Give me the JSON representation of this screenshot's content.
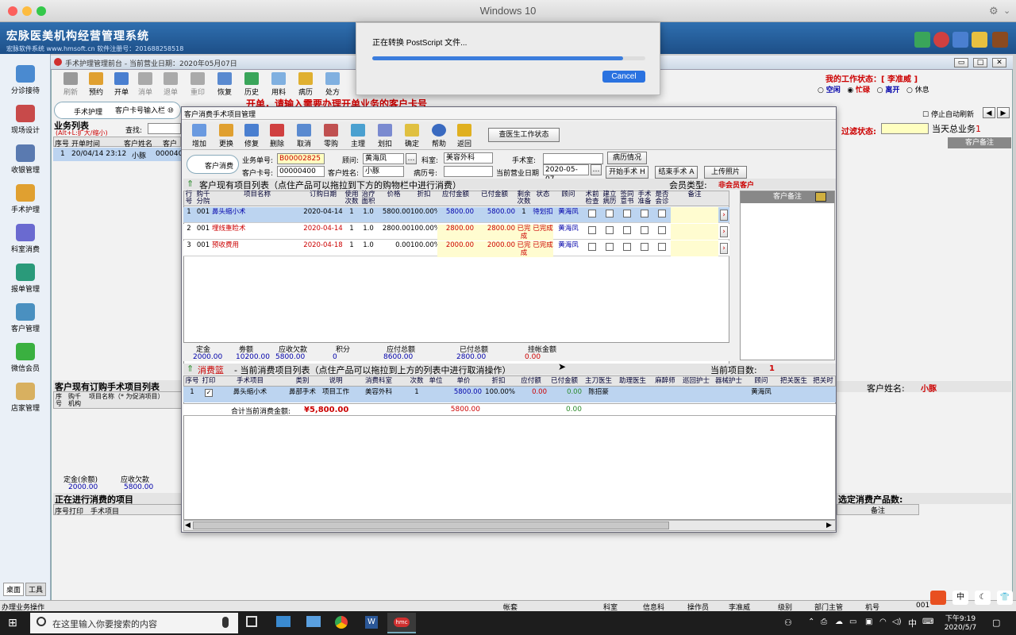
{
  "window": {
    "title": "Windows 10"
  },
  "app": {
    "title": "宏脉医美机构经营管理系统",
    "subtitle": "宏脉软件系统  www.hmsoft.cn  软件注册号：201688258518"
  },
  "sidebar": {
    "items": [
      {
        "label": "分诊接待"
      },
      {
        "label": "现场设计"
      },
      {
        "label": "收银管理"
      },
      {
        "label": "手术护理"
      },
      {
        "label": "科室消费"
      },
      {
        "label": "报单管理"
      },
      {
        "label": "客户管理"
      },
      {
        "label": "微信会员"
      },
      {
        "label": "店家管理"
      }
    ],
    "tabs": [
      "桌面",
      "工具"
    ]
  },
  "inner": {
    "title": "手术护理管理前台 - 当前营业日期：2020年05月07日"
  },
  "toolbar": {
    "items": [
      "刷新",
      "预约",
      "开单",
      "消单",
      "退单",
      "重印",
      "恢复",
      "历史",
      "用料",
      "病历",
      "处方"
    ]
  },
  "status": {
    "label": "我的工作状态：[ 李准威 ]",
    "options": [
      "空闲",
      "忙碌",
      "离开",
      "休息"
    ],
    "auto_refresh": "停止自动刷新"
  },
  "left_panel": {
    "surgery_tag": "手术护理",
    "card_input_label": "客户卡号输入栏 ⑩",
    "prompt": "开单，请输入需要办理开单业务的客户卡号",
    "business_list": "业务列表",
    "business_hint": "(Alt+L:扩大/缩小)",
    "search": "查找:",
    "cols": [
      "序号",
      "开单时间",
      "客户姓名",
      "客户"
    ],
    "row": [
      "1",
      "20/04/14 23:12",
      "小豚",
      "000040"
    ],
    "filter": "过滤状态:",
    "today": "当天总业务",
    "today_count": "1",
    "note_col": "客户备注",
    "order_title": "客户现有订购手术项目列表",
    "order_cols": [
      "序号",
      "购千机构",
      "项目名称（* 为促消项目）"
    ],
    "deposit_label": "定金(余额)",
    "deposit_val": "2000.00",
    "owed_label": "应收欠款",
    "owed_val": "5800.00",
    "ongoing": "正在进行消费的项目",
    "ongoing_cols": [
      "序号打印",
      "手术项目"
    ],
    "customer_name_label": "客户姓名:",
    "customer_name": "小豚",
    "selected_count": "选定消费产品数:",
    "note2": "备注"
  },
  "dialog": {
    "title": "客户消费手术项目管理",
    "toolbar": [
      "增加",
      "更换",
      "修复",
      "删除",
      "取消",
      "零购",
      "主理",
      "划扣",
      "确定",
      "帮助",
      "返回"
    ],
    "check_doctor": "查医生工作状态",
    "tag": "客户消费",
    "form": {
      "order_no_label": "业务单号:",
      "order_no": "B00002825",
      "consultant_label": "顾问:",
      "consultant": "黄海凤",
      "dept_label": "科室:",
      "dept": "美容外科",
      "or_label": "手术室:",
      "history_btn": "病历情况",
      "card_label": "客户卡号:",
      "card": "00000400",
      "name_label": "客户姓名:",
      "name": "小豚",
      "record_label": "病历号:",
      "bizdate_label": "当前营业日期",
      "bizdate": "2020-05-07",
      "start_btn": "开始手术 H",
      "end_btn": "结束手术 A",
      "upload_btn": "上传照片"
    },
    "items_title": "客户现有项目列表（点住产品可以拖拉到下方的购物栏中进行消费）",
    "member_type_label": "会员类型:",
    "member_type": "非会员客户",
    "note_col": "客户备注",
    "items_cols": [
      "行号",
      "购千分院",
      "项目名称",
      "订购日期",
      "使用次数",
      "治疗面积",
      "价格",
      "折扣",
      "应付金额",
      "已付金额",
      "剩余次数",
      "状态",
      "顾问",
      "术前检查",
      "建立病历",
      "签同意书",
      "手术准备",
      "是否会诊",
      "备注"
    ],
    "items": [
      {
        "no": "1",
        "branch": "001",
        "name": "鼻头缩小术",
        "date": "2020-04-14",
        "times": "1",
        "area": "1.0",
        "price": "5800.00",
        "discount": "100.00%",
        "due": "5800.00",
        "paid": "5800.00",
        "left": "1",
        "status": "待划扣",
        "consultant": "黄海凤"
      },
      {
        "no": "2",
        "branch": "001",
        "name": "埋线重睑术",
        "date": "2020-04-14",
        "times": "1",
        "area": "1.0",
        "price": "2800.00",
        "discount": "100.00%",
        "due": "2800.00",
        "paid": "2800.00",
        "left": "已完成",
        "status": "已完成",
        "consultant": "黄海凤"
      },
      {
        "no": "3",
        "branch": "001",
        "name": "预收费用",
        "date": "2020-04-18",
        "times": "1",
        "area": "1.0",
        "price": "0.00",
        "discount": "100.00%",
        "due": "2000.00",
        "paid": "2000.00",
        "left": "已完成",
        "status": "已完成",
        "consultant": "黄海凤"
      }
    ],
    "summary": {
      "labels": [
        "定金",
        "劵额",
        "应收欠款",
        "积分",
        "应付总额",
        "已付总额",
        "挂帐金额"
      ],
      "values": [
        "2000.00",
        "10200.00",
        "5800.00",
        "0",
        "8600.00",
        "2800.00",
        "0.00"
      ]
    },
    "cart_title_a": "消费篮",
    "cart_title_b": "- 当前消费项目列表（点住产品可以拖拉到上方的列表中进行取消操作）",
    "cart_count_label": "当前项目数:",
    "cart_count": "1",
    "cart_cols": [
      "序号",
      "打印",
      "手术项目",
      "类别",
      "说明",
      "消费科室",
      "次数",
      "单位",
      "单价",
      "折扣",
      "应付额",
      "已付金额",
      "主刀医生",
      "助理医生",
      "麻醉师",
      "巡回护士",
      "器械护士",
      "顾问",
      "把关医生",
      "把关时"
    ],
    "cart_row": {
      "no": "1",
      "item": "鼻头缩小术",
      "category": "鼻部手术",
      "desc": "项目工作",
      "dept": "美容外科",
      "times": "1",
      "price": "5800.00",
      "discount": "100.00%",
      "due": "0.00",
      "paid": "0.00",
      "doctor": "陈招豪",
      "consultant": "黄海凤"
    },
    "cart_total_label": "合计当前消费金额:",
    "cart_total": "¥5,800.00",
    "cart_total_price": "5800.00",
    "cart_total_paid": "0.00"
  },
  "sheet": {
    "message": "正在转换 PostScript 文件...",
    "progress": 0.92,
    "cancel": "Cancel"
  },
  "bottom": {
    "left": "办理业务操作",
    "fields": [
      "帐套",
      "科室",
      "信息科",
      "操作员",
      "李准威",
      "级别",
      "部门主管",
      "机号",
      "001"
    ]
  },
  "taskbar": {
    "search": "在这里输入你要搜索的内容",
    "time": "下午9:19",
    "date": "2020/5/7",
    "ime": "中"
  }
}
